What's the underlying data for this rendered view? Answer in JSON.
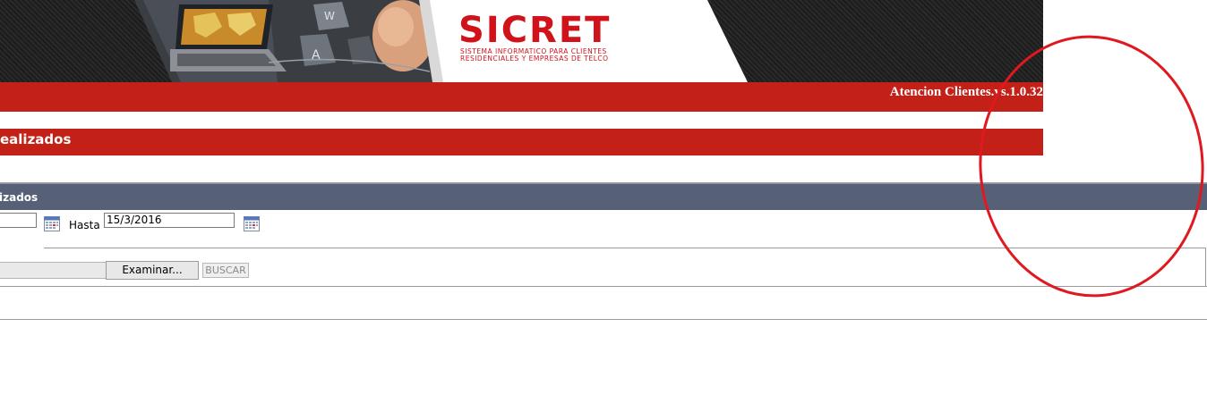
{
  "header": {
    "logo_title": "SICRET",
    "logo_subtitle_line1": "SISTEMA INFORMATICO PARA CLIENTES",
    "logo_subtitle_line2": "RESIDENCIALES Y EMPRESAS DE TELCO",
    "version_text": "Atencion Clientes.vs.1.0.32"
  },
  "section": {
    "title": "ealizados"
  },
  "panel": {
    "title": "izados",
    "hasta_label": "Hasta",
    "hasta_value": "15/3/2016",
    "desde_value": "",
    "browse_label": "Examinar...",
    "search_label": "BUSCAR"
  },
  "icons": {
    "calendar": "calendar-icon",
    "annotation": "red-ellipse-annotation"
  },
  "colors": {
    "brand_red": "#c32017",
    "panel_header": "#566178",
    "annotation_red": "#e0181f"
  }
}
